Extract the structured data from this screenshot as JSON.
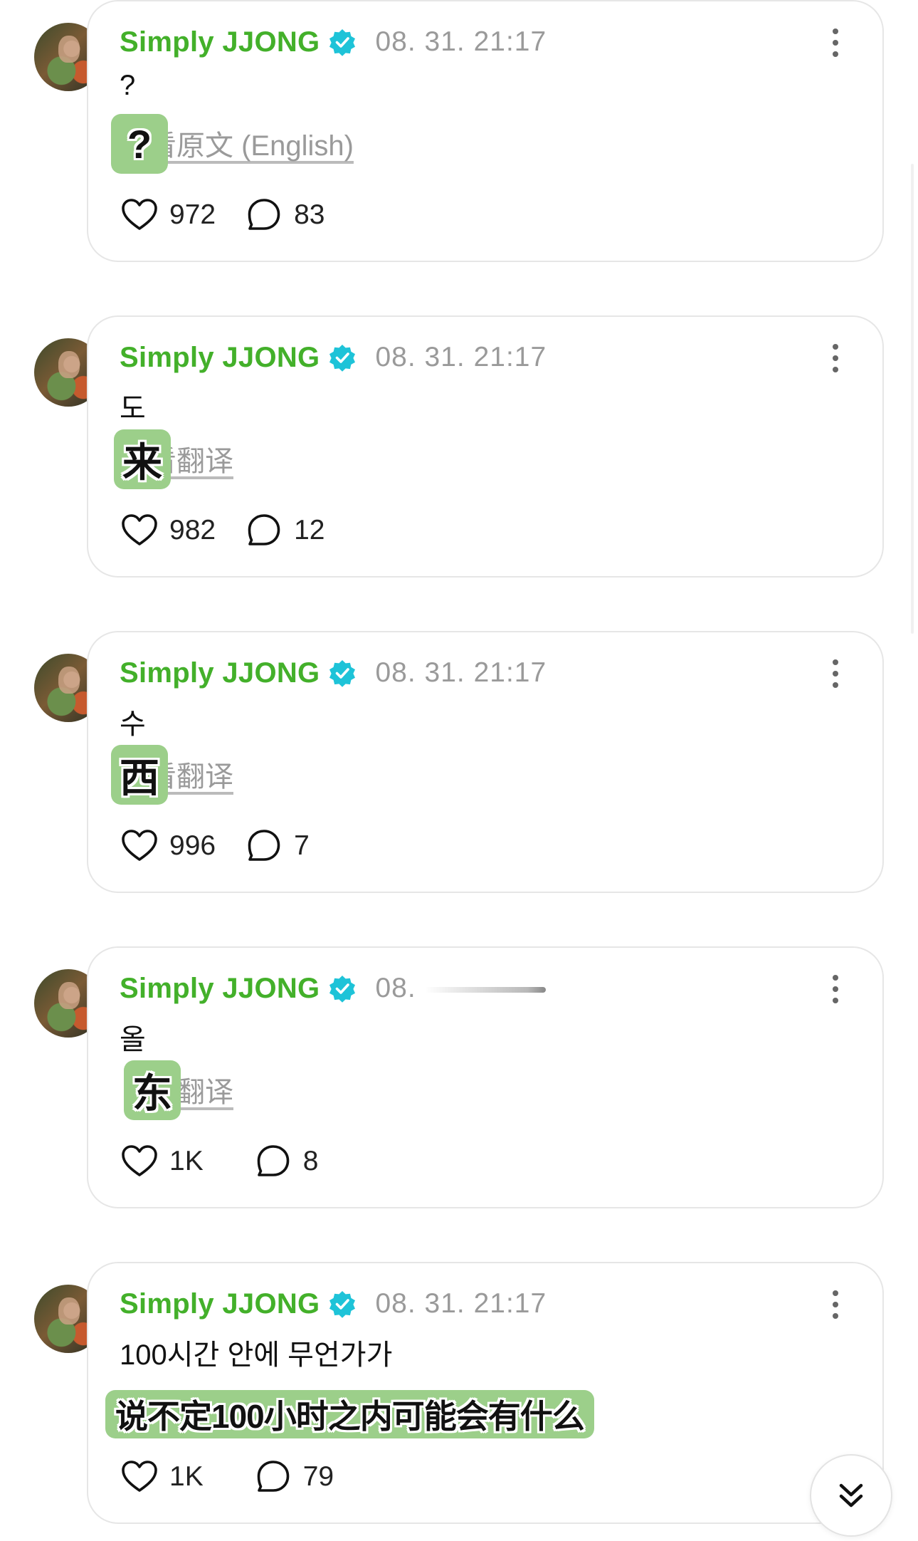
{
  "colors": {
    "username": "#43b02a",
    "verified_badge": "#1ec3d8",
    "timestamp": "#9a9a9a",
    "sticker_bg": "#9ccf8a"
  },
  "icons": {
    "verified": "verified-badge-icon",
    "more": "more-vertical-icon",
    "like": "heart-icon",
    "comment": "comment-bubble-icon",
    "scroll": "double-chevron-down-icon"
  },
  "posts": [
    {
      "username": "Simply JJONG",
      "time": "08. 31. 21:17",
      "text": "?",
      "translate_label": "看原文 (English)",
      "sticker": "?",
      "likes": "972",
      "comments": "83"
    },
    {
      "username": "Simply JJONG",
      "time": "08. 31. 21:17",
      "text": "도",
      "translate_label": "看翻译",
      "sticker": "来",
      "likes": "982",
      "comments": "12"
    },
    {
      "username": "Simply JJONG",
      "time": "08. 31. 21:17",
      "text": "수",
      "translate_label": "看翻译",
      "sticker": "西",
      "likes": "996",
      "comments": "7"
    },
    {
      "username": "Simply JJONG",
      "time": "08.",
      "text": "올",
      "translate_label": "看翻译",
      "sticker": "东",
      "likes": "1K",
      "comments": "8"
    },
    {
      "username": "Simply JJONG",
      "time": "08. 31. 21:17",
      "text": "100시간 안에 무언가가",
      "translate_label": "",
      "sticker": "说不定100小时之内可能会有什么",
      "likes": "1K",
      "comments": "79"
    }
  ]
}
